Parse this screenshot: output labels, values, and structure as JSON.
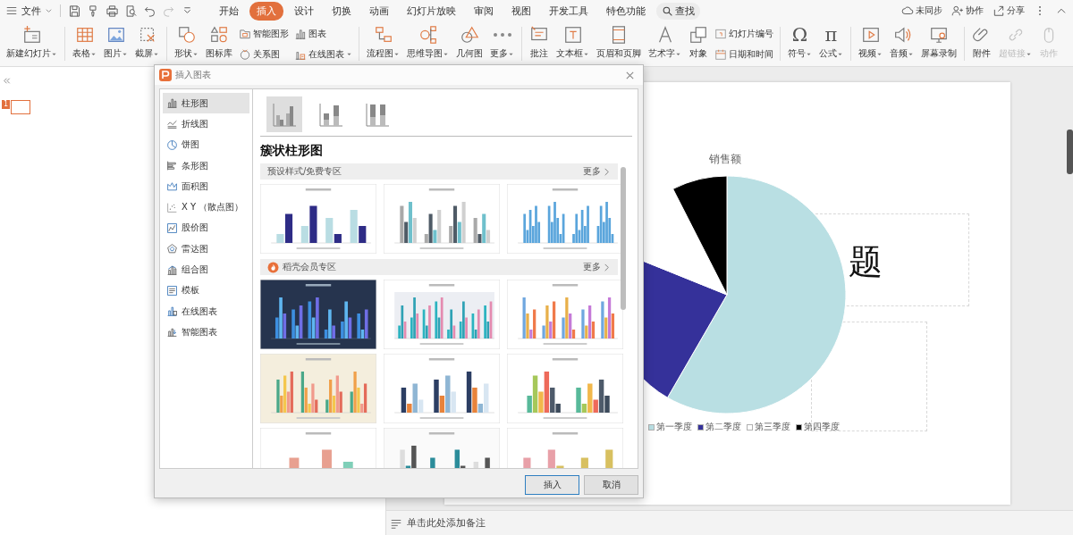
{
  "menu": {
    "label": "文件"
  },
  "tabs": [
    {
      "label": "开始",
      "selected": false
    },
    {
      "label": "插入",
      "selected": true
    },
    {
      "label": "设计",
      "selected": false
    },
    {
      "label": "切换",
      "selected": false
    },
    {
      "label": "动画",
      "selected": false
    },
    {
      "label": "幻灯片放映",
      "selected": false
    },
    {
      "label": "审阅",
      "selected": false
    },
    {
      "label": "视图",
      "selected": false
    },
    {
      "label": "开发工具",
      "selected": false
    },
    {
      "label": "特色功能",
      "selected": false
    }
  ],
  "search": {
    "label": "查找"
  },
  "account_actions": [
    {
      "label": "未同步"
    },
    {
      "label": "协作"
    },
    {
      "label": "分享"
    }
  ],
  "ribbon_groups": [
    [
      {
        "kind": "large",
        "label": "新建幻灯片",
        "dropdown": true,
        "disabled": false
      }
    ],
    [
      {
        "kind": "large",
        "label": "表格",
        "dropdown": true,
        "disabled": false
      },
      {
        "kind": "large",
        "label": "图片",
        "dropdown": true,
        "disabled": false
      },
      {
        "kind": "large",
        "label": "截屏",
        "dropdown": true,
        "disabled": false
      }
    ],
    [
      {
        "kind": "large",
        "label": "形状",
        "dropdown": true,
        "disabled": false
      },
      {
        "kind": "large",
        "label": "图标库",
        "dropdown": false,
        "disabled": false
      },
      {
        "kind": "stack",
        "items": [
          {
            "label": "智能图形",
            "dropdown": false,
            "disabled": false
          },
          {
            "label": "关系图",
            "dropdown": false,
            "disabled": false
          }
        ]
      },
      {
        "kind": "stack",
        "items": [
          {
            "label": "图表",
            "dropdown": false,
            "disabled": false
          },
          {
            "label": "在线图表",
            "dropdown": true,
            "disabled": false
          }
        ]
      }
    ],
    [
      {
        "kind": "large",
        "label": "流程图",
        "dropdown": true,
        "disabled": false
      },
      {
        "kind": "large",
        "label": "思维导图",
        "dropdown": true,
        "disabled": false
      },
      {
        "kind": "large",
        "label": "几何图",
        "dropdown": false,
        "disabled": false
      },
      {
        "kind": "large",
        "label": "更多",
        "dropdown": true,
        "disabled": false
      }
    ],
    [
      {
        "kind": "large",
        "label": "批注",
        "dropdown": false,
        "disabled": false
      },
      {
        "kind": "large",
        "label": "文本框",
        "dropdown": true,
        "disabled": false
      },
      {
        "kind": "large",
        "label": "页眉和页脚",
        "dropdown": false,
        "disabled": false
      },
      {
        "kind": "large",
        "label": "艺术字",
        "dropdown": true,
        "disabled": false
      },
      {
        "kind": "large",
        "label": "对象",
        "dropdown": false,
        "disabled": false
      },
      {
        "kind": "stack",
        "items": [
          {
            "label": "幻灯片编号",
            "dropdown": false,
            "disabled": false
          },
          {
            "label": "日期和时间",
            "dropdown": false,
            "disabled": false
          }
        ]
      }
    ],
    [
      {
        "kind": "glyph",
        "glyph": "Ω",
        "label": "符号",
        "dropdown": true,
        "disabled": false
      },
      {
        "kind": "glyph",
        "glyph": "π",
        "label": "公式",
        "dropdown": true,
        "disabled": false
      }
    ],
    [
      {
        "kind": "large",
        "label": "视频",
        "dropdown": true,
        "disabled": false
      },
      {
        "kind": "large",
        "label": "音频",
        "dropdown": true,
        "disabled": false
      },
      {
        "kind": "large",
        "label": "屏幕录制",
        "dropdown": false,
        "disabled": false
      }
    ],
    [
      {
        "kind": "large",
        "label": "附件",
        "dropdown": false,
        "disabled": false
      },
      {
        "kind": "large",
        "label": "超链接",
        "dropdown": true,
        "disabled": true
      },
      {
        "kind": "large",
        "label": "动作",
        "dropdown": false,
        "disabled": true
      }
    ]
  ],
  "slides": [
    {
      "number": "1",
      "selected": true
    }
  ],
  "slide": {
    "title_fragment": "题",
    "chart_title": "销售额",
    "legend": [
      {
        "label": "第一季度",
        "color": "#b9dfe3"
      },
      {
        "label": "第二季度",
        "color": "#35319a"
      },
      {
        "label": "第三季度",
        "color": "#ffffff"
      },
      {
        "label": "第四季度",
        "color": "#000000"
      }
    ]
  },
  "notes_prompt": "单击此处添加备注",
  "dialog": {
    "title": "插入图表",
    "chart_types": [
      {
        "label": "柱形图",
        "selected": true
      },
      {
        "label": "折线图",
        "selected": false
      },
      {
        "label": "饼图",
        "selected": false
      },
      {
        "label": "条形图",
        "selected": false
      },
      {
        "label": "面积图",
        "selected": false
      },
      {
        "label": "X Y （散点图）",
        "selected": false
      },
      {
        "label": "股价图",
        "selected": false
      },
      {
        "label": "雷达图",
        "selected": false
      },
      {
        "label": "组合图",
        "selected": false
      },
      {
        "label": "模板",
        "selected": false
      },
      {
        "label": "在线图表",
        "selected": false
      },
      {
        "label": "智能图表",
        "selected": false
      }
    ],
    "subtypes": [
      {
        "selected": true
      },
      {
        "selected": false
      },
      {
        "selected": false
      }
    ],
    "heading": "簇状柱形图",
    "sections": [
      {
        "title": "预设样式/免费专区",
        "more": "更多",
        "premium": false
      },
      {
        "title": "稻壳会员专区",
        "more": "更多",
        "premium": true
      }
    ],
    "buttons": [
      {
        "label": "插入",
        "primary": true
      },
      {
        "label": "取消",
        "primary": false
      }
    ]
  }
}
